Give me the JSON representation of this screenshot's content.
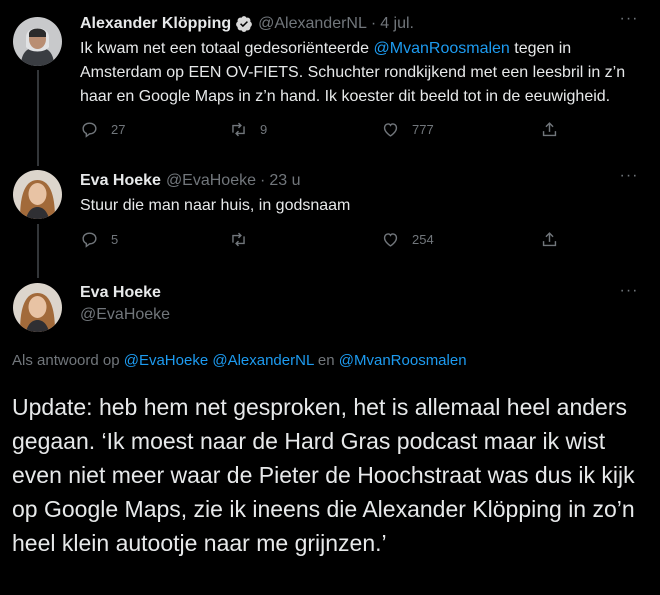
{
  "tweet1": {
    "name": "Alexander Klöpping",
    "handle": "@AlexanderNL",
    "separator": "·",
    "time": "4 jul.",
    "text_1": "Ik kwam net een totaal gedesoriënteerde ",
    "mention": "@MvanRoosmalen",
    "text_2": " tegen in Amsterdam op EEN OV-FIETS. Schuchter rondkijkend met een leesbril in z’n haar en Google Maps in z’n hand. Ik koester dit beeld tot in de eeuwigheid.",
    "replies": "27",
    "retweets": "9",
    "likes": "777",
    "more": "···"
  },
  "tweet2": {
    "name": "Eva Hoeke",
    "handle": "@EvaHoeke",
    "separator": "·",
    "time": "23 u",
    "text": "Stuur die man naar huis, in godsnaam",
    "replies": "5",
    "retweets": "",
    "likes": "254",
    "more": "···"
  },
  "main_tweet": {
    "name": "Eva Hoeke",
    "handle": "@EvaHoeke",
    "more": "···",
    "replying_prefix": "Als antwoord op ",
    "replying_user1": "@EvaHoeke",
    "replying_user2": "@AlexanderNL",
    "replying_and": " en ",
    "replying_user3": "@MvanRoosmalen",
    "text": "Update: heb hem net gesproken, het is allemaal heel anders gegaan. ‘Ik moest naar de Hard Gras podcast maar ik wist even niet meer waar de Pieter de Hoochstraat was dus ik kijk op Google Maps, zie ik ineens die Alexander Klöpping in zo’n heel klein autootje naar me grijnzen.’"
  },
  "colors": {
    "background": "#000000",
    "text": "#e7e9ea",
    "muted": "#71767b",
    "link": "#1d9bf0",
    "thread_line": "#333639"
  },
  "icons": [
    "reply-icon",
    "retweet-icon",
    "like-icon",
    "share-icon",
    "verified-icon",
    "more-icon"
  ]
}
